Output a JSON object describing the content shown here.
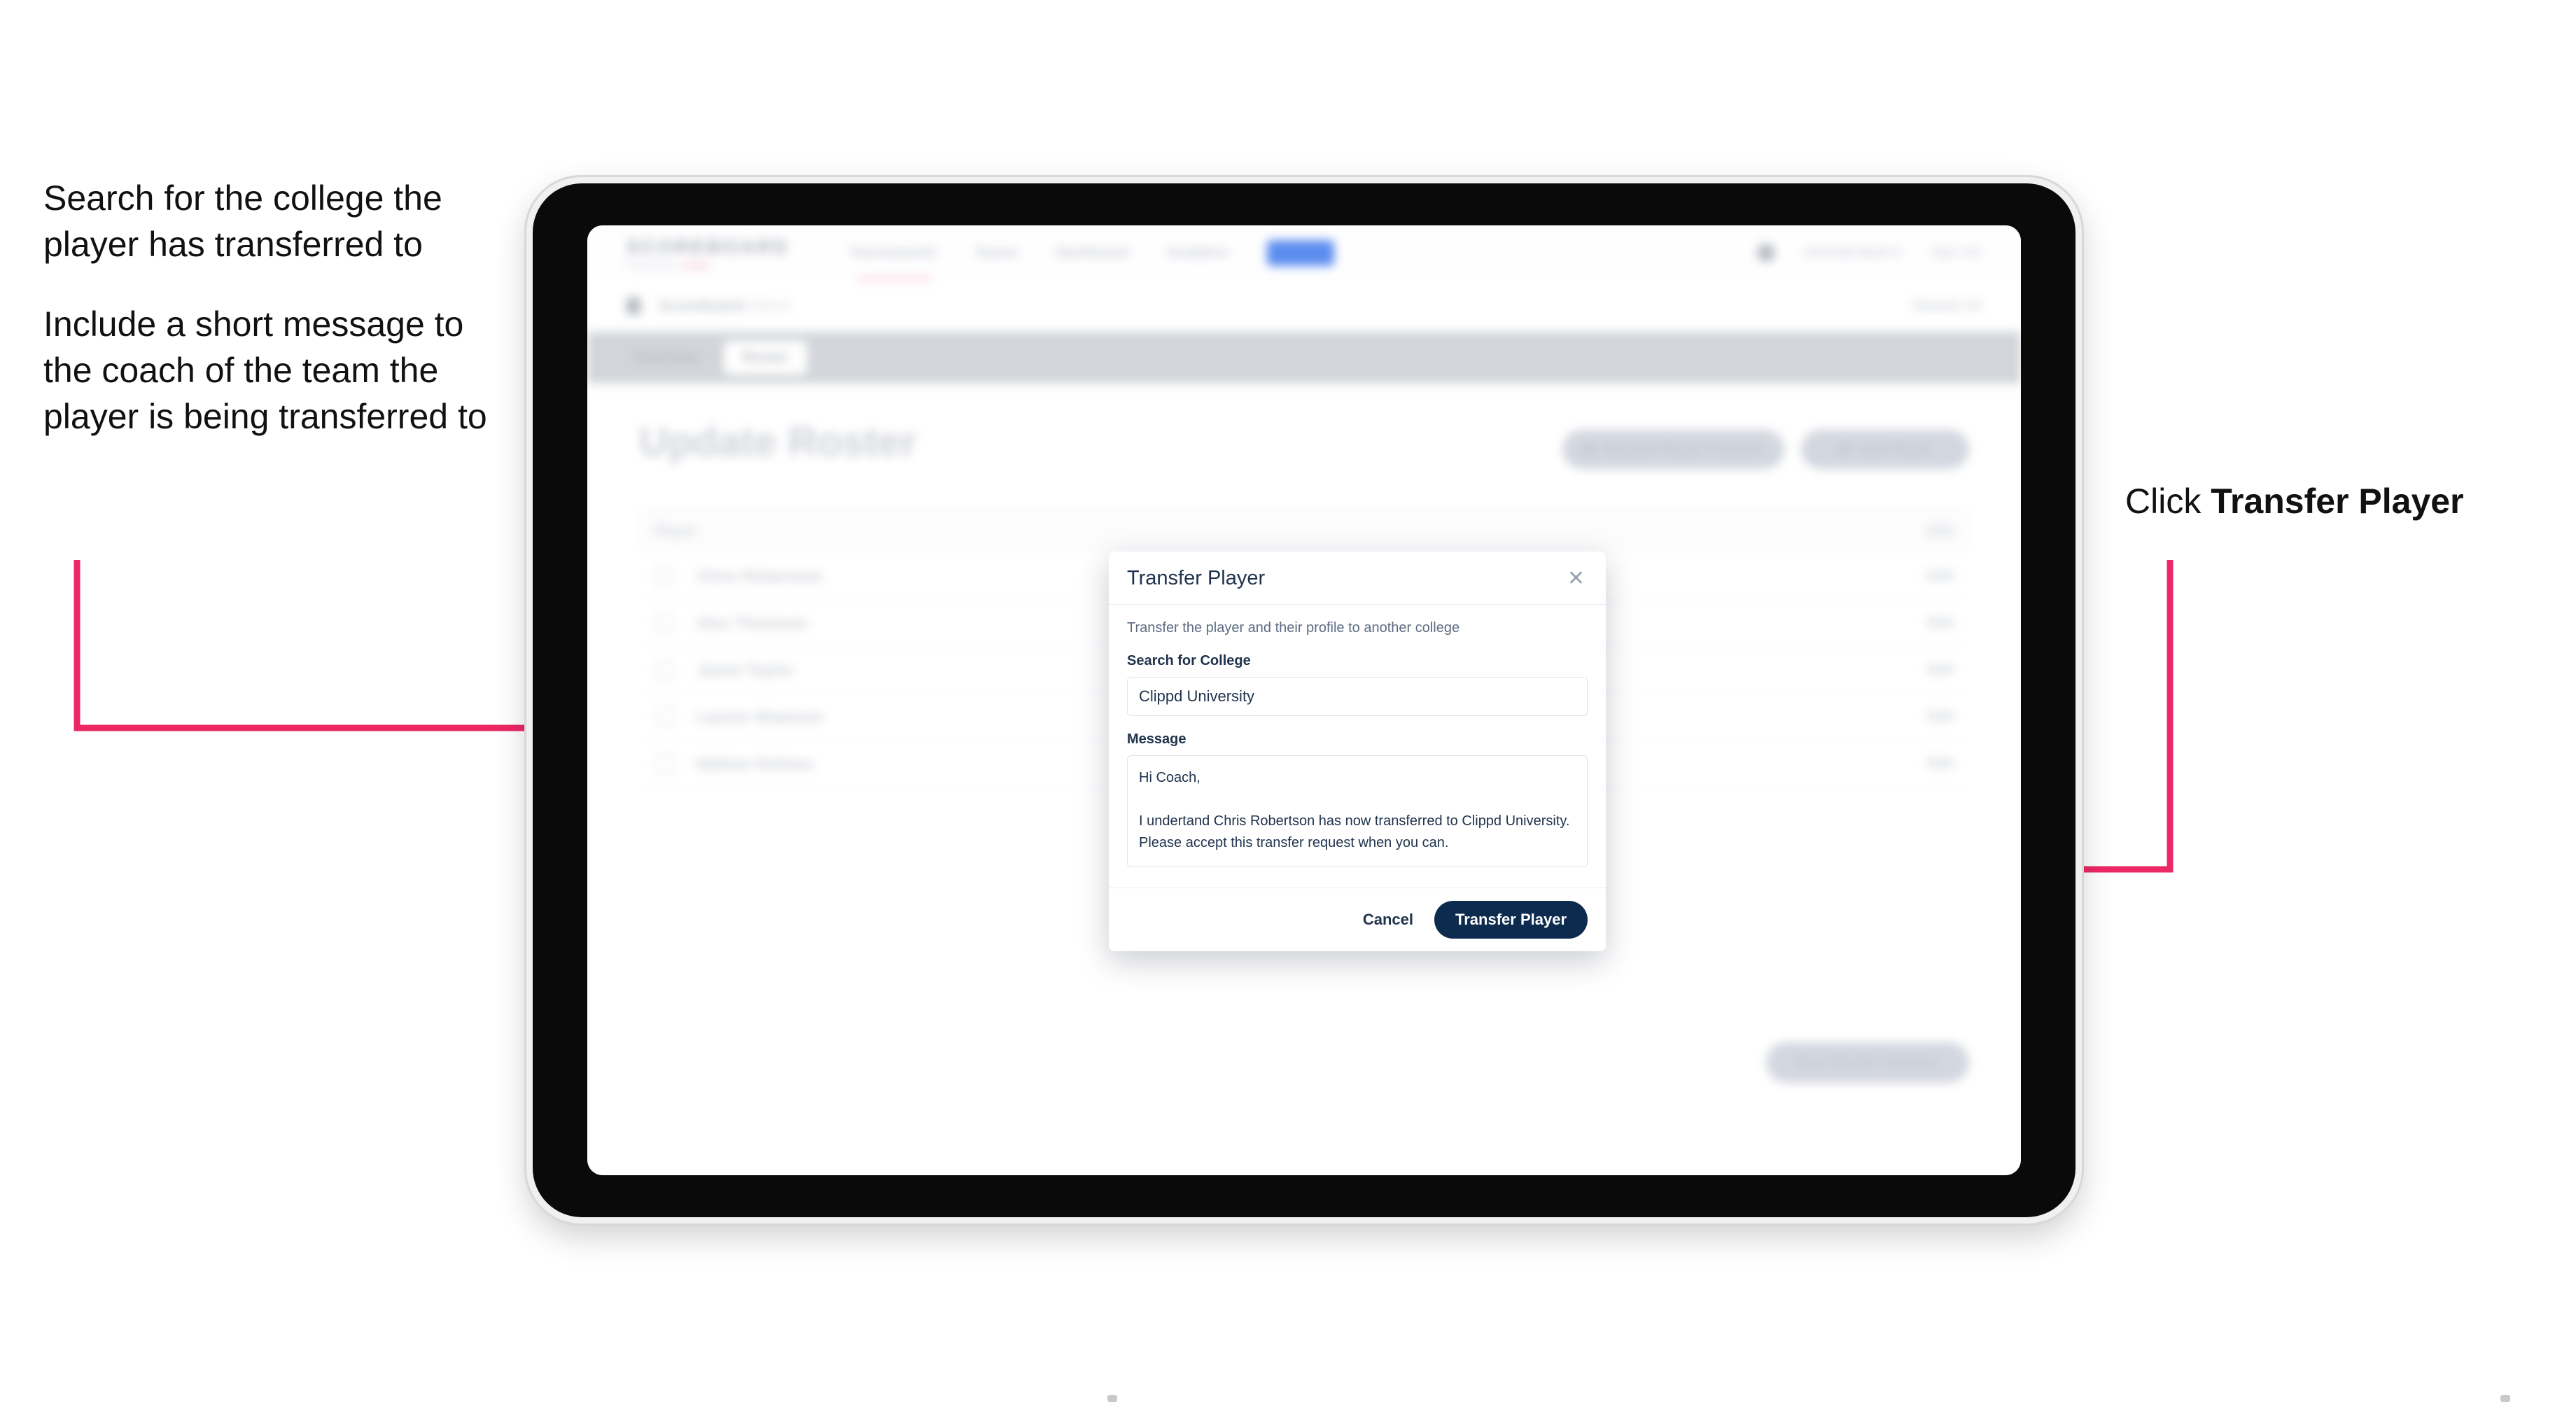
{
  "annotations": {
    "left": [
      "Search for the college the player has transferred to",
      "Include a short message to the coach of the team the player is being transferred to"
    ],
    "right_prefix": "Click ",
    "right_bold": "Transfer Player"
  },
  "app": {
    "navbar": {
      "logo_main": "SCOREBOARD",
      "logo_sub_prefix": "Powered by ",
      "logo_sub_brand": "clippd",
      "links": [
        "Tournaments",
        "Teams",
        "Dashboard",
        "Analytics"
      ],
      "active_link": "Admin",
      "user_email": "admin@clippd.io",
      "sign_out": "Sign Out"
    },
    "breadcrumb": {
      "title": "Scoreboard",
      "subtitle": "Admin",
      "right": "Season 24"
    },
    "tabs": [
      {
        "label": "Overview",
        "active": false
      },
      {
        "label": "Roster",
        "active": true
      }
    ],
    "page_title": "Update Roster",
    "actions": [
      "Request Player Transfer",
      "Add Player"
    ],
    "table": {
      "headers": [
        "Player",
        "Edit"
      ],
      "rows": [
        {
          "name": "Chris Robertson",
          "action": "Edit"
        },
        {
          "name": "Alex Thomson",
          "action": "Edit"
        },
        {
          "name": "Jamie Taylor",
          "action": "Edit"
        },
        {
          "name": "Lauren Shannon",
          "action": "Edit"
        },
        {
          "name": "Nathan Holmes",
          "action": "Edit"
        }
      ]
    },
    "save_button": "Save Roster Updates"
  },
  "modal": {
    "title": "Transfer Player",
    "close_icon": "close-icon",
    "description": "Transfer the player and their profile to another college",
    "college_label": "Search for College",
    "college_value": "Clippd University",
    "college_placeholder": "Search for College",
    "message_label": "Message",
    "message_value": "Hi Coach,\n\nI undertand Chris Robertson has now transferred to Clippd University. Please accept this transfer request when you can.",
    "message_placeholder": "Message",
    "cancel_label": "Cancel",
    "submit_label": "Transfer Player"
  },
  "colors": {
    "accent_pink": "#ec2765",
    "primary_navy": "#0d2b4e",
    "text_dark": "#20334d"
  }
}
